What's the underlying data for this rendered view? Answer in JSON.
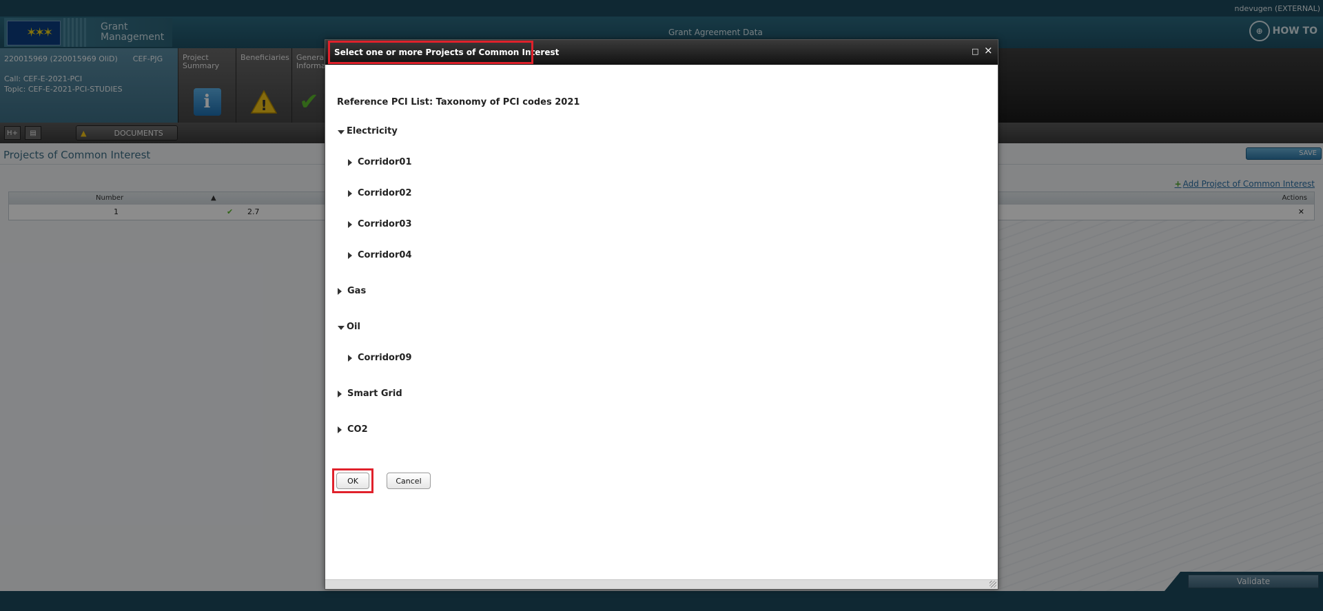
{
  "topbar": {
    "user": "ndevugen (EXTERNAL)"
  },
  "header": {
    "logo_line1": "Grant",
    "logo_line2": "Management",
    "title": "Grant Agreement Data",
    "howto": "HOW TO"
  },
  "project": {
    "id": "220015969 (220015969 OliD)",
    "type": "CEF-PJG",
    "call": "Call: CEF-E-2021-PCI",
    "topic": "Topic: CEF-E-2021-PCI-STUDIES"
  },
  "tabs": [
    {
      "label": "Project Summary"
    },
    {
      "label": "Beneficiaries"
    },
    {
      "label": "General Informa"
    }
  ],
  "toolbar": {
    "documents": "DOCUMENTS"
  },
  "page": {
    "title": "Projects of Common Interest",
    "save": "SAVE",
    "add_link": "Add Project of Common Interest",
    "columns": {
      "number": "Number",
      "actions": "Actions"
    },
    "rows": [
      {
        "number": "1",
        "code": "2.7"
      }
    ],
    "validate": "Validate"
  },
  "modal": {
    "title": "Select one or more Projects of Common Interest",
    "reference": "Reference PCI List: Taxonomy of PCI codes 2021",
    "tree": [
      {
        "label": "Electricity",
        "expanded": true,
        "children": [
          "Corridor01",
          "Corridor02",
          "Corridor03",
          "Corridor04"
        ]
      },
      {
        "label": "Gas",
        "expanded": false,
        "children": []
      },
      {
        "label": "Oil",
        "expanded": true,
        "children": [
          "Corridor09"
        ]
      },
      {
        "label": "Smart Grid",
        "expanded": false,
        "children": []
      },
      {
        "label": "CO2",
        "expanded": false,
        "children": []
      }
    ],
    "ok": "OK",
    "cancel": "Cancel",
    "maximize_icon": "□",
    "close_icon": "×"
  },
  "colors": {
    "highlight": "#e0212b",
    "app_teal": "#1d4a5e"
  }
}
